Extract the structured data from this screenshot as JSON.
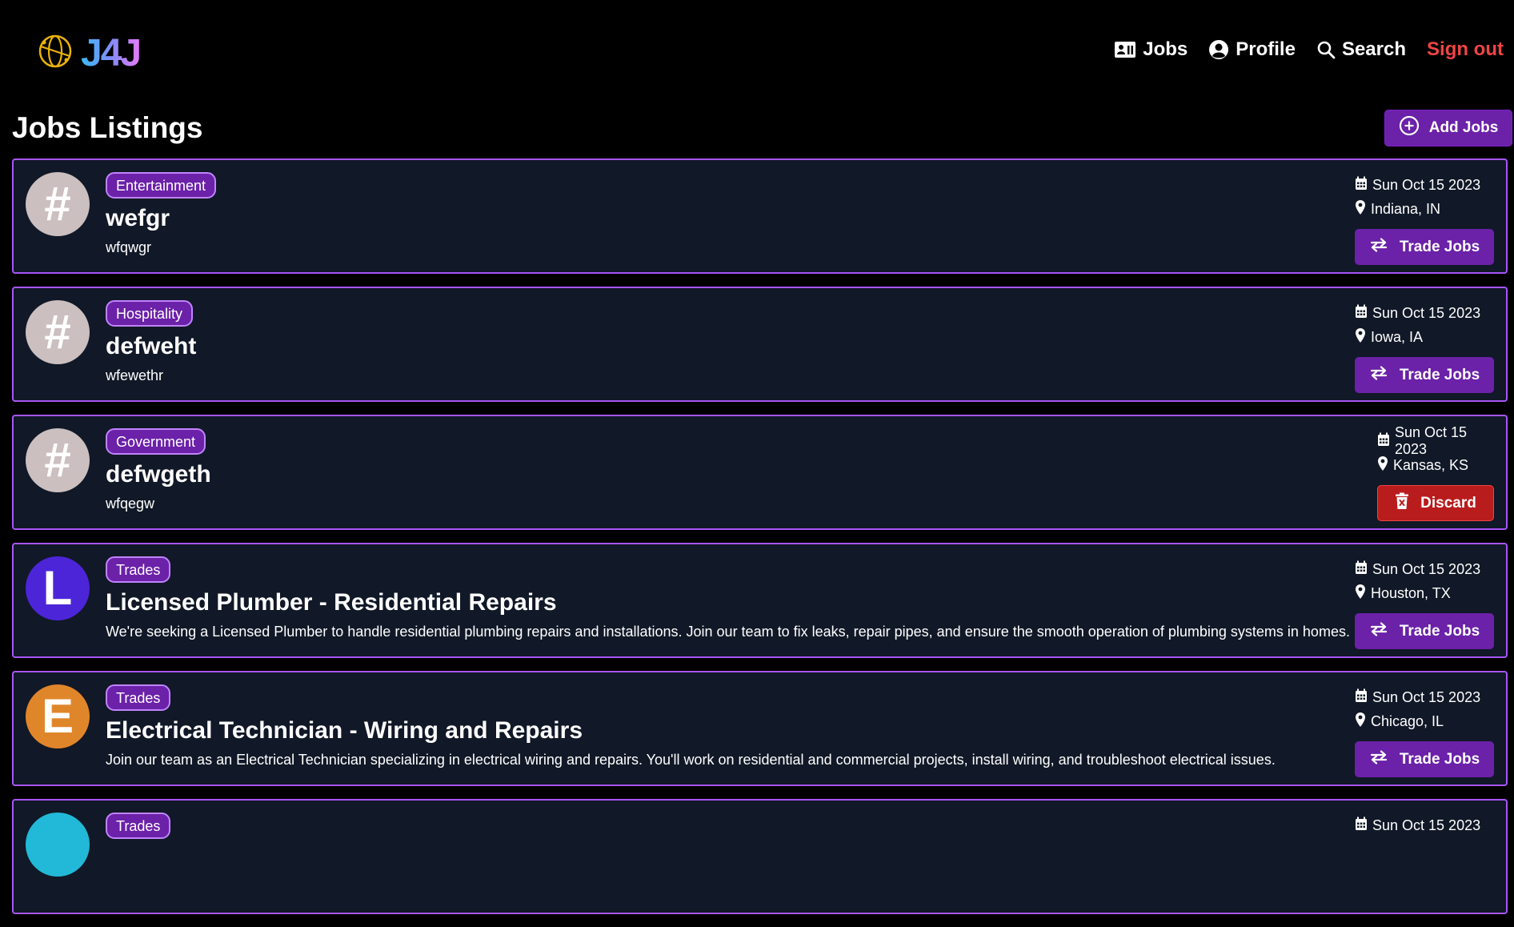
{
  "brand": {
    "logo_text": "J4J",
    "logo_icon": "globe-icon"
  },
  "nav": {
    "jobs": "Jobs",
    "profile": "Profile",
    "search": "Search",
    "sign_out": "Sign out"
  },
  "page": {
    "title": "Jobs Listings",
    "add_button": "Add Jobs"
  },
  "colors": {
    "background": "#000000",
    "card_background": "#111827",
    "card_border": "#a855f7",
    "accent_purple": "#6b21a8",
    "danger_red": "#b91c1c",
    "sign_out_red": "#ef4444"
  },
  "jobs": [
    {
      "avatar_letter": "#",
      "avatar_color": "#cbbfbf",
      "category": "Entertainment",
      "title": "wefgr",
      "description": "wfqwgr",
      "date": "Sun Oct 15 2023",
      "location": "Indiana, IN",
      "action": "Trade Jobs"
    },
    {
      "avatar_letter": "#",
      "avatar_color": "#cbbfbf",
      "category": "Hospitality",
      "title": "defweht",
      "description": "wfewethr",
      "date": "Sun Oct 15 2023",
      "location": "Iowa, IA",
      "action": "Trade Jobs"
    },
    {
      "avatar_letter": "#",
      "avatar_color": "#cbbfbf",
      "category": "Government",
      "title": "defwgeth",
      "description": "wfqegw",
      "date": "Sun Oct 15 2023",
      "location": "Kansas, KS",
      "action": "Discard"
    },
    {
      "avatar_letter": "L",
      "avatar_color": "#4c25d9",
      "category": "Trades",
      "title": "Licensed Plumber - Residential Repairs",
      "description": "We're seeking a Licensed Plumber to handle residential plumbing repairs and installations. Join our team to fix leaks, repair pipes, and ensure the smooth operation of plumbing systems in homes.",
      "date": "Sun Oct 15 2023",
      "location": "Houston, TX",
      "action": "Trade Jobs"
    },
    {
      "avatar_letter": "E",
      "avatar_color": "#e0862a",
      "category": "Trades",
      "title": "Electrical Technician - Wiring and Repairs",
      "description": "Join our team as an Electrical Technician specializing in electrical wiring and repairs. You'll work on residential and commercial projects, install wiring, and troubleshoot electrical issues.",
      "date": "Sun Oct 15 2023",
      "location": "Chicago, IL",
      "action": "Trade Jobs"
    },
    {
      "avatar_letter": "",
      "avatar_color": "#22b8d8",
      "category": "Trades",
      "title": "",
      "description": "",
      "date": "Sun Oct 15 2023",
      "location": "",
      "action": ""
    }
  ]
}
